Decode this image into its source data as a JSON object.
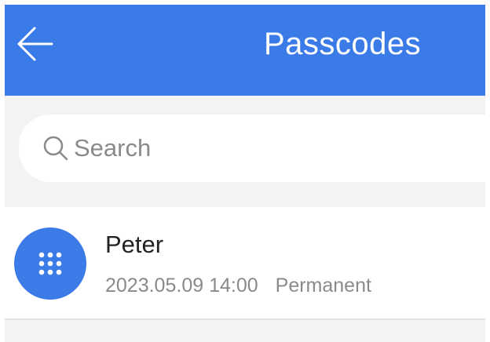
{
  "header": {
    "title": "Passcodes",
    "back_icon": "arrow-left-icon",
    "background_color": "#3a7be8"
  },
  "search": {
    "placeholder": "Search",
    "icon": "search-icon"
  },
  "passcodes": [
    {
      "name": "Peter",
      "datetime": "2023.05.09 14:00",
      "type": "Permanent",
      "icon": "keypad-icon"
    }
  ]
}
